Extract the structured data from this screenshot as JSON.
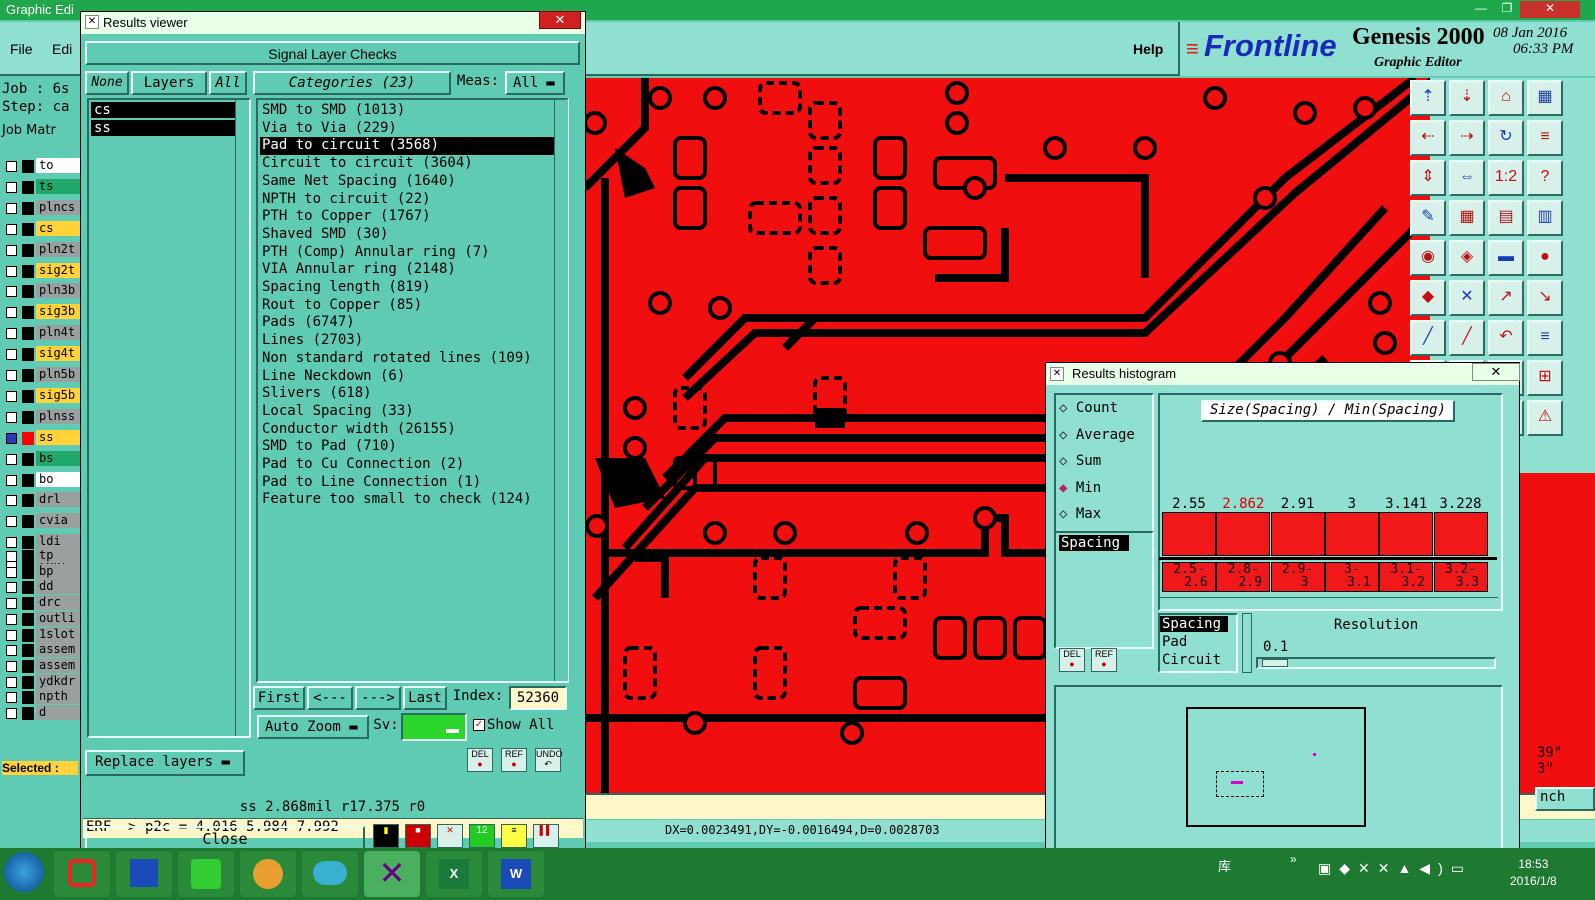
{
  "main_window": {
    "title": "Graphic Edi",
    "title_rest": "...",
    "menu": {
      "file": "File",
      "edit": "Edi",
      "help": "Help"
    },
    "logo": "Frontline",
    "product": "Genesis 2000",
    "subtitle": "Graphic Editor",
    "date": "08 Jan 2016",
    "time": "06:33 PM",
    "job_label": "Job : 6s",
    "step_label": "Step: ca",
    "job_matrix_label": "Job Matr",
    "selected_label": "Selected :",
    "coords": "DX=0.0023491,DY=-0.0016494,D=0.0028703",
    "side_values": [
      "39\"",
      "3\""
    ],
    "inch_label": "nch"
  },
  "layers": [
    {
      "name": "to",
      "color": "#ffffff"
    },
    {
      "name": "ts",
      "color": "#1fa86a"
    },
    {
      "name": "plncs",
      "color": "#9aa0a0"
    },
    {
      "name": "cs",
      "color": "#ffd23a"
    },
    {
      "name": "pln2t",
      "color": "#9aa0a0"
    },
    {
      "name": "sig2t",
      "color": "#ffd23a"
    },
    {
      "name": "pln3b",
      "color": "#9aa0a0"
    },
    {
      "name": "sig3b",
      "color": "#ffd23a"
    },
    {
      "name": "pln4t",
      "color": "#9aa0a0"
    },
    {
      "name": "sig4t",
      "color": "#ffd23a"
    },
    {
      "name": "pln5b",
      "color": "#9aa0a0"
    },
    {
      "name": "sig5b",
      "color": "#ffd23a"
    },
    {
      "name": "plnss",
      "color": "#9aa0a0"
    },
    {
      "name": "ss",
      "color": "#ffd23a"
    },
    {
      "name": "bs",
      "color": "#1fa86a"
    },
    {
      "name": "bo",
      "color": "#ffffff"
    },
    {
      "name": "drl",
      "color": "#9aa0a0"
    },
    {
      "name": "cvia",
      "color": "#9aa0a0"
    },
    {
      "name": "ldi",
      "color": "#9aa0a0"
    },
    {
      "name": "rout",
      "color": "#9aa0a0"
    },
    {
      "name": "tp",
      "color": "#9aa0a0"
    },
    {
      "name": "bp",
      "color": "#9aa0a0"
    },
    {
      "name": "dd",
      "color": "#9aa0a0"
    },
    {
      "name": "drc",
      "color": "#9aa0a0"
    },
    {
      "name": "outli",
      "color": "#9aa0a0"
    },
    {
      "name": "1slot",
      "color": "#9aa0a0"
    },
    {
      "name": "assem",
      "color": "#9aa0a0"
    },
    {
      "name": "assem",
      "color": "#9aa0a0"
    },
    {
      "name": "ydkdr",
      "color": "#9aa0a0"
    },
    {
      "name": "npth",
      "color": "#9aa0a0"
    },
    {
      "name": "d",
      "color": "#9aa0a0"
    }
  ],
  "results_viewer": {
    "title": "Results viewer",
    "close_x": "✕",
    "header": "Signal Layer Checks",
    "none_btn": "None",
    "layers_btn": "Layers",
    "all_btn": "All",
    "categories_label": "Categories (23)",
    "meas_label": "Meas:",
    "meas_value": "All",
    "selected_layers": [
      "cs",
      "ss"
    ],
    "categories": [
      "SMD to SMD (1013)",
      "Via to Via (229)",
      "Pad to circuit (3568)",
      "Circuit to circuit (3604)",
      "Same Net Spacing (1640)",
      "NPTH to circuit (22)",
      "PTH to Copper (1767)",
      "Shaved SMD (30)",
      "PTH (Comp) Annular ring (7)",
      "VIA Annular ring (2148)",
      "Spacing length (819)",
      "Rout to Copper (85)",
      "Pads (6747)",
      "Lines (2703)",
      "Non standard rotated lines (109)",
      "Line Neckdown (6)",
      "Slivers (618)",
      "Local Spacing (33)",
      "Conductor width (26155)",
      "SMD to Pad (710)",
      "Pad to Cu Connection (2)",
      "Pad to Line Connection (1)",
      "Feature too small to check (124)"
    ],
    "selected_category_index": 2,
    "nav": {
      "first": "First",
      "prev": "<---",
      "next": "--->",
      "last": "Last",
      "index_label": "Index:",
      "index_value": "52360"
    },
    "auto_zoom": "Auto Zoom",
    "sv_label": "Sv:",
    "show_all": "Show All",
    "replace_layers": "Replace layers",
    "del": "DEL",
    "ref": "REF",
    "undo": "UNDO",
    "info": "ss 2.868mil  r17.375  r0",
    "erf": "ERF--> p2c = 4.016 5.984 7.992",
    "close": "Close"
  },
  "histogram": {
    "title": "Results histogram",
    "options": [
      "Count",
      "Average",
      "Sum",
      "Min",
      "Max"
    ],
    "selected_option": "Min",
    "chart_title": "Size(Spacing) / Min(Spacing)",
    "field_list": [
      "Spacing"
    ],
    "del": "DEL",
    "ref": "REF",
    "bar_values": [
      "2.55",
      "2.862",
      "2.91",
      "3",
      "3.141",
      "3.228"
    ],
    "highlight_index": 1,
    "ranges": [
      [
        "2.5-",
        "2.6"
      ],
      [
        "2.8-",
        "2.9"
      ],
      [
        "2.9-",
        "3"
      ],
      [
        "3-",
        "3.1"
      ],
      [
        "3.1-",
        "3.2"
      ],
      [
        "3.2-",
        "3.3"
      ]
    ],
    "by_list": [
      "Spacing",
      "Pad",
      "Circuit"
    ],
    "resolution_label": "Resolution",
    "resolution_value": "0.1"
  },
  "taskbar": {
    "tray_text": "库",
    "clock_time": "18:53",
    "clock_date": "2016/1/8"
  },
  "colors": {
    "copper": "#f00e0e",
    "panel": "#5fcbb2",
    "light_panel": "#8fe0d0"
  }
}
